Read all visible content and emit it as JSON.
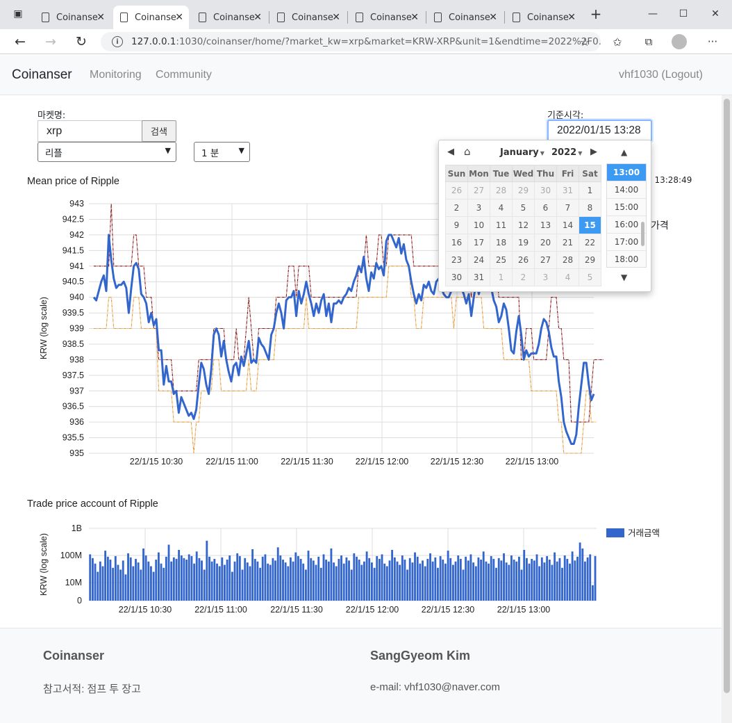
{
  "browser": {
    "tabs": [
      {
        "label": "Coinanse",
        "active": false
      },
      {
        "label": "Coinanse",
        "active": true
      },
      {
        "label": "Coinanse",
        "active": false
      },
      {
        "label": "Coinanse",
        "active": false
      },
      {
        "label": "Coinanse",
        "active": false
      },
      {
        "label": "Coinanse",
        "active": false
      },
      {
        "label": "Coinanse",
        "active": false
      }
    ],
    "url_host": "127.0.0.1",
    "url_rest": ":1030/coinanser/home/?market_kw=xrp&market=KRW-XRP&unit=1&endtime=2022%2F0..."
  },
  "navbar": {
    "brand": "Coinanser",
    "links": [
      "Monitoring",
      "Community"
    ],
    "user": "vhf1030 (Logout)"
  },
  "form": {
    "market_label": "마켓명:",
    "market_value": "xrp",
    "search_label": "검색",
    "market_select": "리플",
    "unit_select": "1 분",
    "time_label": "기준시각:",
    "time_value": "2022/01/15 13:28"
  },
  "partial_text": {
    "time_suffix": "5 13:28:49",
    "word": "가격"
  },
  "datepicker": {
    "month": "January",
    "year": "2022",
    "weekdays": [
      "Sun",
      "Mon",
      "Tue",
      "Wed",
      "Thu",
      "Fri",
      "Sat"
    ],
    "weeks": [
      [
        "26",
        "27",
        "28",
        "29",
        "30",
        "31",
        "1"
      ],
      [
        "2",
        "3",
        "4",
        "5",
        "6",
        "7",
        "8"
      ],
      [
        "9",
        "10",
        "11",
        "12",
        "13",
        "14",
        "15"
      ],
      [
        "16",
        "17",
        "18",
        "19",
        "20",
        "21",
        "22"
      ],
      [
        "23",
        "24",
        "25",
        "26",
        "27",
        "28",
        "29"
      ],
      [
        "30",
        "31",
        "1",
        "2",
        "3",
        "4",
        "5"
      ]
    ],
    "selected_day": "15",
    "times": [
      "13:00",
      "14:00",
      "15:00",
      "16:00",
      "17:00",
      "18:00"
    ],
    "selected_time": "13:00"
  },
  "chart_data": [
    {
      "type": "line",
      "title": "Mean price of Ripple",
      "ylabel": "KRW (log scale)",
      "log_scale": true,
      "ylim": [
        935,
        943
      ],
      "yticks": [
        "943",
        "942.5",
        "942",
        "941.5",
        "941",
        "940.5",
        "940",
        "939.5",
        "939",
        "938.5",
        "938",
        "937.5",
        "937",
        "936.5",
        "936",
        "935.5",
        "935"
      ],
      "xticks": [
        "22/1/15 10:30",
        "22/1/15 11:00",
        "22/1/15 11:30",
        "22/1/15 12:00",
        "22/1/15 12:30",
        "22/1/15 13:00"
      ],
      "series": [
        {
          "role": "mean",
          "color": "#3366cc",
          "values": [
            940,
            939.9,
            940.2,
            940.5,
            940.7,
            940.2,
            942,
            941.2,
            940.6,
            940.3,
            940.4,
            940.4,
            940.5,
            940.3,
            939.5,
            940.3,
            941,
            941.1,
            940.9,
            940.1,
            940,
            939.8,
            939.2,
            939.5,
            939.1,
            939.3,
            938.3,
            938.3,
            937.2,
            937.8,
            937.3,
            937.3,
            936.9,
            937,
            936.3,
            936.8,
            936.6,
            936.4,
            936.2,
            936.3,
            936.1,
            936.4,
            937.2,
            937.9,
            937.7,
            937.2,
            936.9,
            937.7,
            938.8,
            939,
            938.8,
            938.1,
            938.6,
            938,
            937.6,
            937.3,
            937.8,
            937.9,
            937.5,
            938.1,
            937.8,
            938.2,
            938.6,
            937.9,
            938,
            937.9,
            938.7,
            938.5,
            938.4,
            938.2,
            938,
            938.8,
            939,
            939.5,
            939.8,
            939.5,
            939,
            939.9,
            940,
            940,
            940.2,
            939.4,
            940.2,
            939.8,
            940.1,
            940.5,
            940.1,
            939.8,
            939.4,
            939.8,
            939.5,
            939.9,
            940.1,
            939.4,
            939.8,
            939.2,
            939.8,
            939.8,
            939.9,
            939.8,
            940,
            940.1,
            940.3,
            940.2,
            940.5,
            940.7,
            941,
            940.8,
            941.3,
            940.6,
            940.2,
            940.8,
            940.6,
            941.1,
            940.9,
            941,
            940.7,
            941.8,
            942,
            942,
            941.8,
            941.6,
            941.9,
            941.4,
            941.7,
            941.2,
            941,
            940.5,
            940.1,
            939.8,
            940.1,
            939.9,
            940.4,
            940.3,
            940.5,
            940.2,
            940.1,
            940.5,
            940.6,
            940.3,
            940.1,
            940,
            940,
            940.2,
            940.6,
            940.2,
            940.7,
            940.3,
            940.1,
            939.8,
            940.1,
            939.4,
            940,
            940.5,
            940.1,
            940.4,
            940.3,
            940.7,
            940.5,
            940.3,
            939.9,
            939.7,
            939.2,
            939.4,
            939.8,
            939.6,
            939,
            938.3,
            938.2,
            938.9,
            939.4,
            938.8,
            938,
            938.3,
            938.1,
            938.2,
            938.2,
            938.2,
            938.5,
            939,
            939.3,
            939.2,
            938.9,
            938.4,
            938.1,
            938.1,
            937.3,
            936.8,
            936,
            935.7,
            935.5,
            935.3,
            935.3,
            935.6,
            936.5,
            937.2,
            937.9,
            937.9,
            937.2,
            936.7,
            936.9
          ]
        },
        {
          "role": "high",
          "color": "#8b1a1a",
          "values": [
            941,
            941,
            941,
            941,
            941,
            941,
            941,
            943,
            941,
            941,
            941,
            941,
            941,
            941,
            941,
            941,
            942,
            942,
            941,
            941,
            941,
            940,
            940,
            940,
            939,
            939,
            938,
            938,
            938,
            938,
            938,
            938,
            937,
            937,
            937,
            937,
            937,
            937,
            937,
            937,
            937,
            937,
            938,
            938,
            938,
            938,
            938,
            938,
            939,
            939,
            939,
            939,
            939,
            938,
            938,
            938,
            938,
            939,
            938,
            938,
            938,
            939,
            940,
            939,
            938,
            938,
            939,
            939,
            939,
            939,
            939,
            939,
            939,
            940,
            940,
            940,
            940,
            940,
            941,
            941,
            941,
            940,
            941,
            941,
            941,
            941,
            941,
            940,
            940,
            940,
            940,
            940,
            940,
            940,
            940,
            940,
            940,
            940,
            940,
            940,
            940,
            940,
            940,
            940,
            940,
            940,
            941,
            941,
            941,
            942,
            941,
            941,
            941,
            941,
            942,
            942,
            941,
            941,
            942,
            942,
            942,
            942,
            942,
            942,
            942,
            942,
            942,
            942,
            941,
            941,
            941,
            941,
            941,
            941,
            941,
            941,
            941,
            941,
            941,
            941,
            941,
            941,
            941,
            941,
            941,
            941,
            941,
            941,
            941,
            941,
            941,
            940,
            941,
            941,
            941,
            941,
            941,
            941,
            941,
            941,
            941,
            941,
            940,
            940,
            940,
            940,
            940,
            940,
            940,
            940,
            940,
            938,
            938,
            939,
            939,
            939,
            938,
            938,
            938,
            938,
            938,
            938,
            939,
            940,
            940,
            940,
            939,
            939,
            938,
            938,
            938,
            936,
            936,
            936,
            936,
            936,
            936,
            936,
            936,
            937,
            938,
            938,
            938,
            938,
            938
          ]
        },
        {
          "role": "low",
          "color": "#e89c3a",
          "values": [
            939,
            939,
            939,
            939,
            939,
            939,
            940,
            940,
            939,
            939,
            939,
            939,
            939,
            939,
            939,
            939,
            940,
            940,
            940,
            939,
            939,
            939,
            939,
            939,
            939,
            939,
            937,
            937,
            937,
            937,
            937,
            937,
            936,
            936,
            936,
            936,
            936,
            936,
            936,
            936,
            935,
            936,
            936,
            937,
            937,
            937,
            937,
            937,
            938,
            938,
            938,
            937,
            937,
            937,
            937,
            937,
            937,
            937,
            937,
            937,
            937,
            937,
            938,
            937,
            937,
            937,
            938,
            938,
            938,
            938,
            938,
            938,
            938,
            939,
            939,
            939,
            939,
            939,
            939,
            939,
            939,
            939,
            939,
            939,
            939,
            940,
            939,
            939,
            939,
            939,
            939,
            939,
            939,
            939,
            939,
            939,
            939,
            939,
            939,
            939,
            939,
            939,
            939,
            939,
            939,
            939,
            940,
            940,
            940,
            940,
            940,
            940,
            940,
            940,
            940,
            940,
            940,
            940,
            941,
            941,
            941,
            941,
            941,
            941,
            941,
            941,
            941,
            940,
            940,
            939,
            939,
            939,
            940,
            940,
            940,
            940,
            940,
            940,
            940,
            940,
            940,
            940,
            940,
            940,
            939,
            940,
            940,
            940,
            940,
            940,
            940,
            940,
            940,
            940,
            940,
            940,
            939,
            939,
            939,
            939,
            939,
            939,
            939,
            939,
            938,
            938,
            938,
            938,
            938,
            938,
            938,
            938,
            938,
            938,
            938,
            937,
            937,
            937,
            937,
            937,
            937,
            937,
            937,
            937,
            937,
            937,
            936,
            936,
            935,
            935,
            935,
            935,
            935,
            935,
            935,
            935,
            936,
            937,
            937,
            936,
            936,
            936
          ]
        }
      ]
    },
    {
      "type": "bar",
      "title": "Trade price account of Ripple",
      "ylabel": "KRW (log scale)",
      "log_scale": true,
      "yticks": [
        "1B",
        "100M",
        "10M",
        "0"
      ],
      "xticks": [
        "22/1/15 10:30",
        "22/1/15 11:00",
        "22/1/15 11:30",
        "22/1/15 12:00",
        "22/1/15 12:30",
        "22/1/15 13:00"
      ],
      "series": [
        {
          "name": "거래금액",
          "color": "#3366cc",
          "values": [
            110000000,
            80000000,
            50000000,
            25000000,
            60000000,
            40000000,
            150000000,
            90000000,
            70000000,
            35000000,
            95000000,
            45000000,
            30000000,
            65000000,
            20000000,
            120000000,
            85000000,
            40000000,
            75000000,
            55000000,
            30000000,
            180000000,
            100000000,
            60000000,
            40000000,
            25000000,
            70000000,
            130000000,
            50000000,
            35000000,
            90000000,
            250000000,
            60000000,
            85000000,
            75000000,
            160000000,
            100000000,
            80000000,
            70000000,
            110000000,
            95000000,
            50000000,
            140000000,
            80000000,
            65000000,
            30000000,
            350000000,
            90000000,
            60000000,
            75000000,
            50000000,
            40000000,
            85000000,
            45000000,
            70000000,
            100000000,
            25000000,
            60000000,
            120000000,
            95000000,
            30000000,
            80000000,
            55000000,
            40000000,
            170000000,
            75000000,
            60000000,
            35000000,
            90000000,
            110000000,
            50000000,
            45000000,
            80000000,
            65000000,
            200000000,
            100000000,
            70000000,
            55000000,
            40000000,
            85000000,
            60000000,
            130000000,
            95000000,
            75000000,
            50000000,
            30000000,
            150000000,
            80000000,
            65000000,
            45000000,
            90000000,
            35000000,
            110000000,
            70000000,
            60000000,
            180000000,
            55000000,
            40000000,
            75000000,
            100000000,
            50000000,
            85000000,
            65000000,
            30000000,
            120000000,
            90000000,
            70000000,
            45000000,
            60000000,
            140000000,
            80000000,
            55000000,
            35000000,
            95000000,
            75000000,
            110000000,
            50000000,
            40000000,
            65000000,
            160000000,
            85000000,
            60000000,
            45000000,
            100000000,
            70000000,
            30000000,
            80000000,
            55000000,
            130000000,
            90000000,
            50000000,
            65000000,
            40000000,
            75000000,
            120000000,
            60000000,
            85000000,
            35000000,
            95000000,
            70000000,
            50000000,
            150000000,
            80000000,
            45000000,
            60000000,
            100000000,
            75000000,
            30000000,
            90000000,
            65000000,
            110000000,
            55000000,
            40000000,
            85000000,
            70000000,
            140000000,
            60000000,
            50000000,
            95000000,
            75000000,
            35000000,
            80000000,
            65000000,
            120000000,
            55000000,
            45000000,
            100000000,
            70000000,
            60000000,
            90000000,
            30000000,
            160000000,
            80000000,
            50000000,
            75000000,
            65000000,
            110000000,
            40000000,
            85000000,
            55000000,
            95000000,
            70000000,
            45000000,
            130000000,
            60000000,
            80000000,
            35000000,
            100000000,
            75000000,
            50000000,
            140000000,
            65000000,
            90000000,
            300000000,
            180000000,
            60000000,
            85000000,
            110000000,
            8000000,
            95000000
          ]
        }
      ]
    }
  ],
  "footer": {
    "left_title": "Coinanser",
    "left_text": "참고서적: 점프 투 장고",
    "right_title": "SangGyeom Kim",
    "right_text": "e-mail: vhf1030@naver.com"
  }
}
